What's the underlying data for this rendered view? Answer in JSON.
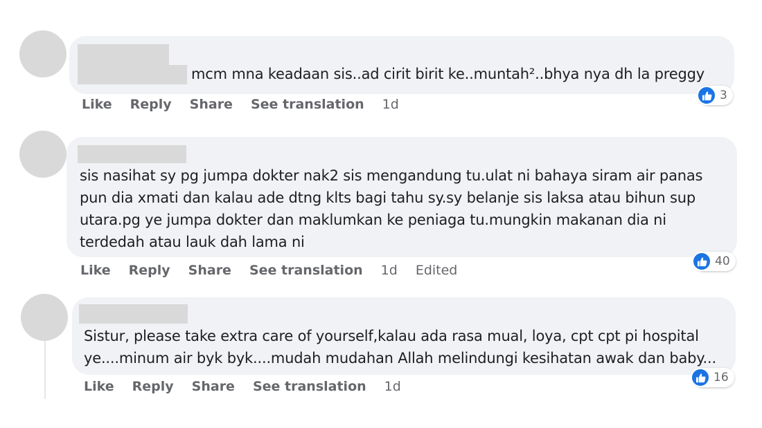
{
  "comments": [
    {
      "lines": [
        "mcm mna keadaan sis..ad cirit birit ke..muntah²..bhya nya dh la preggy"
      ],
      "actions": {
        "like": "Like",
        "reply": "Reply",
        "share": "Share",
        "translate": "See translation"
      },
      "time": "1d",
      "edited": "",
      "reactions": "3"
    },
    {
      "lines": [
        "sis nasihat sy pg jumpa dokter nak2 sis mengandung tu.ulat ni bahaya siram air panas",
        "pun dia xmati dan kalau ade dtng klts bagi tahu sy.sy belanje sis laksa atau bihun sup",
        "utara.pg ye jumpa dokter dan maklumkan ke peniaga tu.mungkin makanan dia ni",
        "terdedah atau lauk dah lama ni"
      ],
      "actions": {
        "like": "Like",
        "reply": "Reply",
        "share": "Share",
        "translate": "See translation"
      },
      "time": "1d",
      "edited": "Edited",
      "reactions": "40"
    },
    {
      "lines": [
        "Sistur, please take extra care of yourself,kalau ada rasa mual, loya, cpt cpt pi hospital",
        "ye....minum air byk byk....mudah mudahan Allah melindungi kesihatan awak dan baby..."
      ],
      "actions": {
        "like": "Like",
        "reply": "Reply",
        "share": "Share",
        "translate": "See translation"
      },
      "time": "1d",
      "edited": "",
      "reactions": "16"
    }
  ],
  "colors": {
    "like_blue": "#1b74e4",
    "bubble_bg": "#f0f2f5",
    "muted_text": "#65676b",
    "redaction": "#d9d9d9"
  },
  "icons": {
    "reaction": "thumbs-up-icon"
  }
}
